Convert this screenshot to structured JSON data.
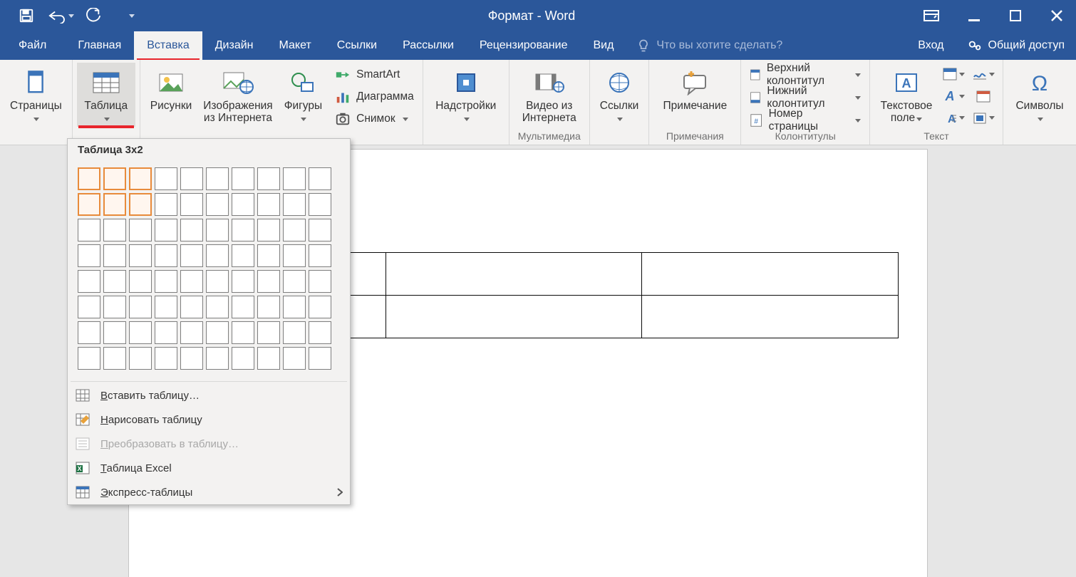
{
  "app": {
    "title": "Формат - Word"
  },
  "qat": {
    "items": [
      "save",
      "undo",
      "redo",
      "customize"
    ]
  },
  "tabs": {
    "file": "Файл",
    "home": "Главная",
    "insert": "Вставка",
    "design": "Дизайн",
    "layout": "Макет",
    "references": "Ссылки",
    "mailings": "Рассылки",
    "review": "Рецензирование",
    "view": "Вид"
  },
  "tellme": "Что вы хотите сделать?",
  "signin": "Вход",
  "share": "Общий доступ",
  "ribbon": {
    "pages": {
      "big": "Страницы"
    },
    "tables": {
      "big": "Таблица"
    },
    "illustrations": {
      "pictures": "Рисунки",
      "online_pics": "Изображения\nиз Интернета",
      "shapes": "Фигуры",
      "smartart": "SmartArt",
      "chart": "Диаграмма",
      "screenshot": "Снимок"
    },
    "addins": {
      "big": "Надстройки"
    },
    "media": {
      "big": "Видео из\nИнтернета",
      "label": "Мультимедиа"
    },
    "links": {
      "big": "Ссылки"
    },
    "comments": {
      "big": "Примечание",
      "label": "Примечания"
    },
    "headerfooter": {
      "header": "Верхний колонтитул",
      "footer": "Нижний колонтитул",
      "pagenum": "Номер страницы",
      "label": "Колонтитулы"
    },
    "text": {
      "big": "Текстовое\nполе",
      "label": "Текст"
    },
    "symbols": {
      "big": "Символы"
    }
  },
  "dropdown": {
    "title": "Таблица 3x2",
    "selection": {
      "cols": 3,
      "rows": 2
    },
    "grid": {
      "cols": 10,
      "rows": 8
    },
    "insert": "Вставить таблицу…",
    "draw": "Нарисовать таблицу",
    "convert": "Преобразовать в таблицу…",
    "excel": "Таблица Excel",
    "quick": "Экспресс-таблицы"
  }
}
